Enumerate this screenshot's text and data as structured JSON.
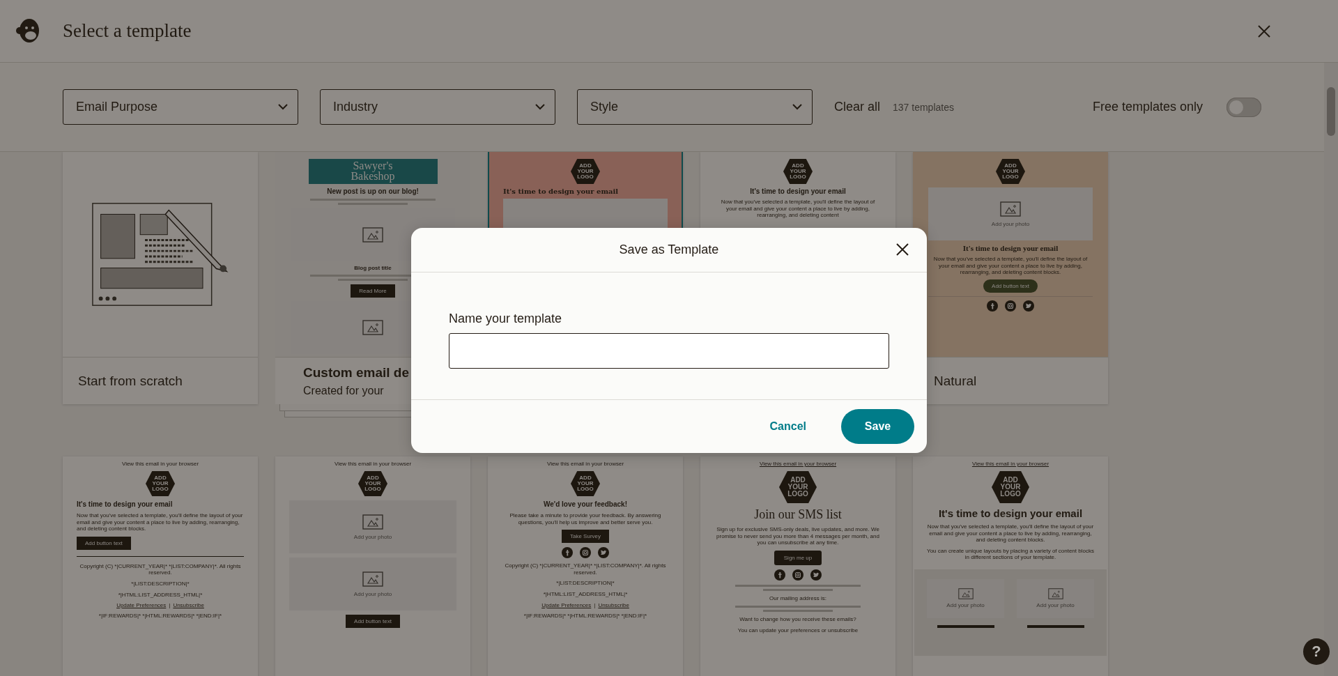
{
  "header": {
    "title": "Select a template"
  },
  "filters": {
    "dropdowns": [
      {
        "label": "Email Purpose"
      },
      {
        "label": "Industry"
      },
      {
        "label": "Style"
      }
    ],
    "clear_all": "Clear all",
    "count": "137 templates",
    "free_toggle": {
      "label": "Free templates only",
      "on": false
    }
  },
  "templates_row_1": [
    {
      "kind": "scratch",
      "selected": false,
      "label": "Start from scratch"
    },
    {
      "kind": "email",
      "selected": false,
      "stacked": true,
      "color": "#888480",
      "label": "Custom email de",
      "sublabel": "Created for your",
      "blocks": [
        {
          "kind": "banner",
          "text": "Sawyer's Bakeshop",
          "color": "#194848"
        },
        {
          "kind": "heading",
          "text": "New post is up on our blog!"
        },
        {
          "kind": "blurred"
        },
        {
          "kind": "image"
        },
        {
          "kind": "subheading",
          "text": "Blog post title"
        },
        {
          "kind": "blurred"
        },
        {
          "kind": "button",
          "text": "Read More",
          "color": "#1d170f"
        },
        {
          "kind": "image"
        }
      ]
    },
    {
      "kind": "email",
      "selected": true,
      "color": "#896157",
      "blocks": [
        {
          "kind": "logo",
          "text": "ADD YOUR LOGO"
        },
        {
          "kind": "slabheading",
          "text": "It's time to design your email"
        },
        {
          "kind": "panel"
        }
      ]
    },
    {
      "kind": "email",
      "selected": false,
      "color": "#8f8b87",
      "blocks": [
        {
          "kind": "logo",
          "text": "ADD YOUR LOGO"
        },
        {
          "kind": "heading",
          "text": "It's time to design your email"
        },
        {
          "kind": "text",
          "text": "Now that you've selected a template, you'll define the layout of your email and give your content a place to live by adding, rearranging, and deleting content"
        }
      ]
    },
    {
      "kind": "email",
      "selected": false,
      "color": "#857362",
      "label": "Natural",
      "blocks": [
        {
          "kind": "logo",
          "text": "ADD YOUR LOGO"
        },
        {
          "kind": "photo",
          "text": "Add your photo"
        },
        {
          "kind": "serifheading",
          "text": "It's time to design your email"
        },
        {
          "kind": "text",
          "text": "Now that you've selected a template, you'll define the layout of your email and give your content a place to live by adding, rearranging, and deleting content blocks."
        },
        {
          "kind": "pillbutton",
          "text": "Add button text",
          "color": "#2d301a"
        },
        {
          "kind": "rule"
        },
        {
          "kind": "social"
        }
      ]
    }
  ],
  "templates_row_2": [
    {
      "kind": "email",
      "selected": false,
      "color": "#8f8b87",
      "blocks": [
        {
          "kind": "link",
          "text": "View this email in your browser",
          "underlined": false
        },
        {
          "kind": "logo",
          "text": "ADD YOUR LOGO"
        },
        {
          "kind": "leftheading",
          "text": "It's time to design your email"
        },
        {
          "kind": "lefttext",
          "text": "Now that you've selected a template, you'll define the layout of your email and give your content a place to live by adding, rearranging, and deleting content blocks."
        },
        {
          "kind": "leftbutton",
          "text": "Add button text",
          "color": "#1d170f"
        },
        {
          "kind": "thickrule"
        },
        {
          "kind": "text",
          "text": "Copyright (C) *|CURRENT_YEAR|* *|LIST:COMPANY|*. All rights reserved."
        },
        {
          "kind": "text",
          "text": "*|LIST:DESCRIPTION|*"
        },
        {
          "kind": "text",
          "text": "*|HTML:LIST_ADDRESS_HTML|*"
        },
        {
          "kind": "links",
          "items": [
            "Update Preferences",
            "Unsubscribe"
          ],
          "separator": "|"
        },
        {
          "kind": "text",
          "text": "*|IF:REWARDS|* *|HTML:REWARDS|* *|END:IF|*"
        }
      ]
    },
    {
      "kind": "email",
      "selected": false,
      "color": "#8f8b87",
      "blocks": [
        {
          "kind": "link",
          "text": "View this email in your browser",
          "underlined": false
        },
        {
          "kind": "logo",
          "text": "ADD YOUR LOGO"
        },
        {
          "kind": "photo",
          "text": "Add your photo"
        },
        {
          "kind": "photo",
          "text": "Add your photo"
        },
        {
          "kind": "button",
          "text": "Add button text",
          "color": "#1d170f"
        }
      ]
    },
    {
      "kind": "email",
      "selected": false,
      "color": "#8f8b87",
      "blocks": [
        {
          "kind": "link",
          "text": "View this email in your browser",
          "underlined": false
        },
        {
          "kind": "logo",
          "text": "ADD YOUR LOGO"
        },
        {
          "kind": "heading",
          "text": "We'd love your feedback!"
        },
        {
          "kind": "text",
          "text": "Please take a minute to provide your feedback. By answering questions, you'll help us improve and better serve you."
        },
        {
          "kind": "button",
          "text": "Take Survey",
          "color": "#1d170f"
        },
        {
          "kind": "social"
        },
        {
          "kind": "text",
          "text": "Copyright (C) *|CURRENT_YEAR|* *|LIST:COMPANY|*. All rights reserved."
        },
        {
          "kind": "text",
          "text": "*|LIST:DESCRIPTION|*"
        },
        {
          "kind": "text",
          "text": "*|HTML:LIST_ADDRESS_HTML|*"
        },
        {
          "kind": "links",
          "items": [
            "Update Preferences",
            "Unsubscribe"
          ],
          "separator": "|"
        },
        {
          "kind": "text",
          "text": "*|IF:REWARDS|* *|HTML:REWARDS|* *|END:IF|*"
        }
      ]
    },
    {
      "kind": "email",
      "selected": false,
      "color": "#8f8b87",
      "blocks": [
        {
          "kind": "link",
          "text": "View this email in your browser",
          "underlined": true
        },
        {
          "kind": "biglogo",
          "text": "ADD YOUR LOGO"
        },
        {
          "kind": "displayheading",
          "text": "Join our SMS list"
        },
        {
          "kind": "text",
          "text": "Sign up for exclusive SMS-only deals, live updates, and more. We promise to never send you more than 4 messages per month, and you can unsubscribe at any time."
        },
        {
          "kind": "roundbutton",
          "text": "Sign me up",
          "color": "#1d170f"
        },
        {
          "kind": "social"
        },
        {
          "kind": "blurred"
        },
        {
          "kind": "text",
          "text": "Our mailing address is:"
        },
        {
          "kind": "blurred"
        },
        {
          "kind": "text",
          "text": "Want to change how you receive these emails?"
        },
        {
          "kind": "text",
          "text": "You can update your preferences or unsubscribe"
        }
      ]
    },
    {
      "kind": "email",
      "selected": false,
      "color": "#8f8b87",
      "blocks": [
        {
          "kind": "link",
          "text": "View this email in your browser",
          "underlined": true
        },
        {
          "kind": "biglogo",
          "text": "ADD YOUR LOGO"
        },
        {
          "kind": "bigheading",
          "text": "It's time to design your email"
        },
        {
          "kind": "text",
          "text": "Now that you've selected a template, you'll define the layout of your email and give your content a place to live by adding, rearranging, and deleting content blocks."
        },
        {
          "kind": "text",
          "text": "You can create unique layouts by placing a variety of content blocks in different sections of your template."
        },
        {
          "kind": "photopair",
          "items": [
            "Add your photo",
            "Add your photo"
          ]
        }
      ]
    }
  ],
  "dialog": {
    "title": "Save as Template",
    "field_label": "Name your template",
    "cancel": "Cancel",
    "save": "Save"
  },
  "help_button": {
    "label": "?"
  }
}
